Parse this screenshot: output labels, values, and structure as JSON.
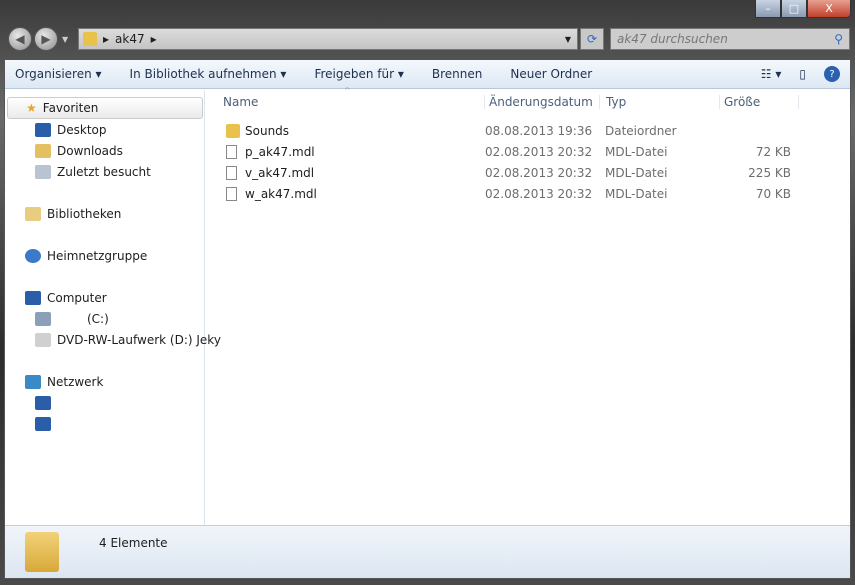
{
  "window": {
    "minimize": "–",
    "maximize": "□",
    "close": "X"
  },
  "address": {
    "path": [
      "ak47"
    ]
  },
  "search": {
    "placeholder": "ak47 durchsuchen"
  },
  "toolbar": {
    "organize": "Organisieren ▾",
    "library": "In Bibliothek aufnehmen ▾",
    "share": "Freigeben für ▾",
    "burn": "Brennen",
    "new_folder": "Neuer Ordner",
    "help": "?"
  },
  "sidebar": {
    "favorites": "Favoriten",
    "desktop": "Desktop",
    "downloads": "Downloads",
    "recent": "Zuletzt besucht",
    "libraries": "Bibliotheken",
    "homegroup": "Heimnetzgruppe",
    "computer": "Computer",
    "drive_c": "(C:)",
    "drive_d": "DVD-RW-Laufwerk (D:) Jeky",
    "network": "Netzwerk"
  },
  "columns": {
    "name": "Name",
    "date": "Änderungsdatum",
    "type": "Typ",
    "size": "Größe"
  },
  "files": [
    {
      "name": "Sounds",
      "date": "08.08.2013 19:36",
      "type": "Dateiordner",
      "size": ""
    },
    {
      "name": "p_ak47.mdl",
      "date": "02.08.2013 20:32",
      "type": "MDL-Datei",
      "size": "72 KB"
    },
    {
      "name": "v_ak47.mdl",
      "date": "02.08.2013 20:32",
      "type": "MDL-Datei",
      "size": "225 KB"
    },
    {
      "name": "w_ak47.mdl",
      "date": "02.08.2013 20:32",
      "type": "MDL-Datei",
      "size": "70 KB"
    }
  ],
  "status": {
    "count": "4 Elemente"
  }
}
